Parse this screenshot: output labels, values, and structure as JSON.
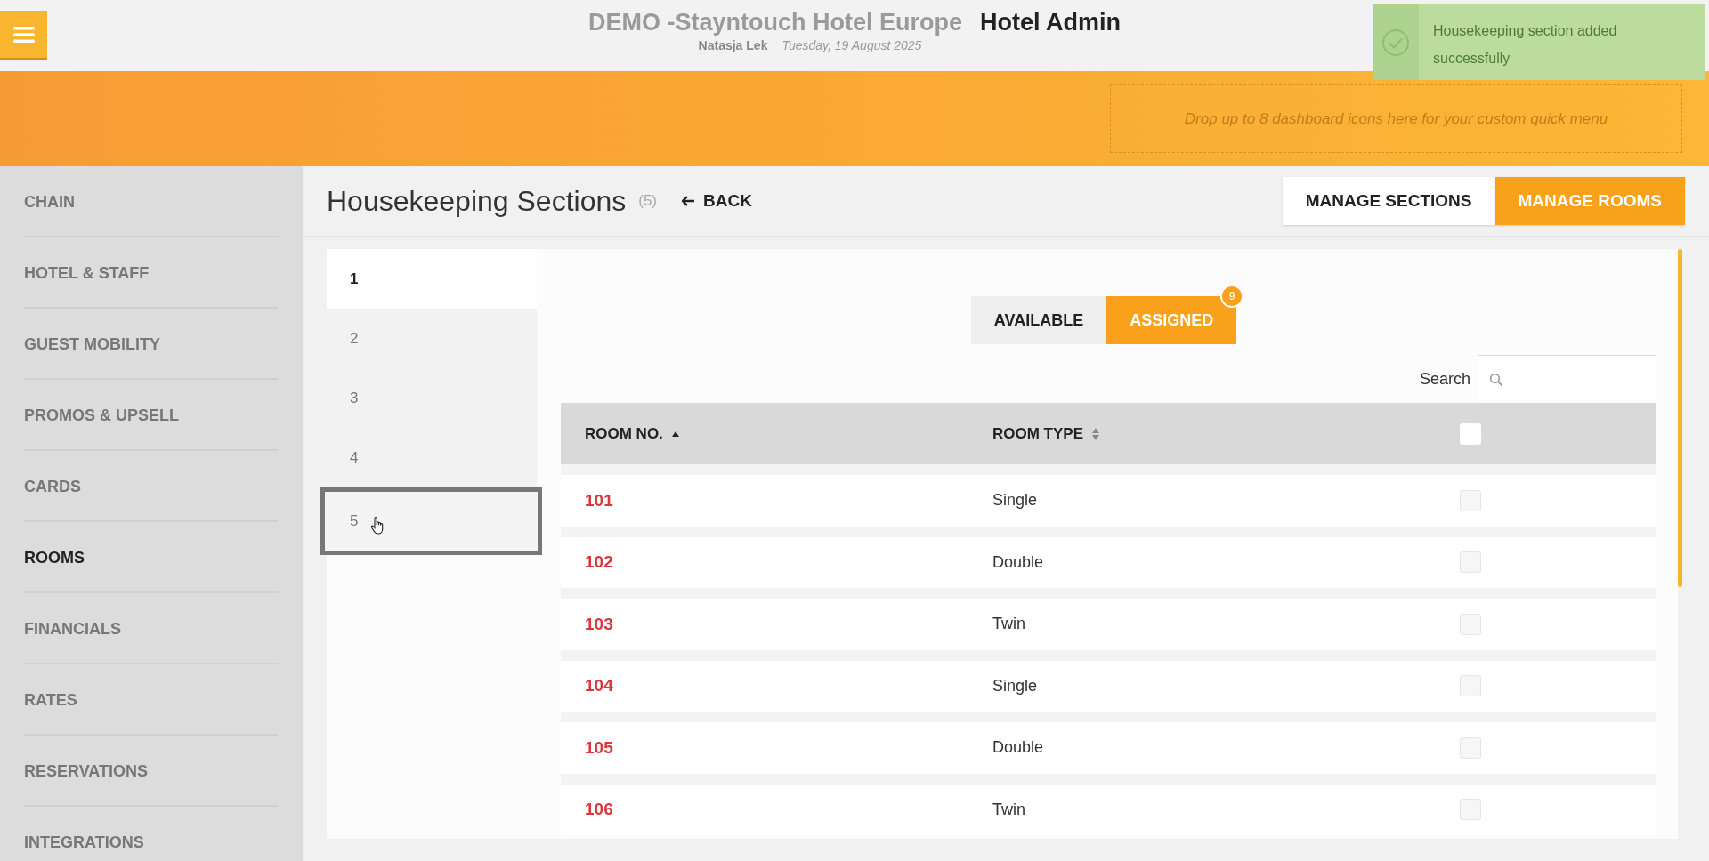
{
  "header": {
    "title": "DEMO -Stayntouch Hotel Europe",
    "app": "Hotel Admin",
    "user": "Natasja Lek",
    "date": "Tuesday, 19 August 2025"
  },
  "toast": {
    "message": "Housekeeping section added successfully"
  },
  "quick_menu": {
    "hint": "Drop up to 8 dashboard icons here for your custom quick menu"
  },
  "sidebar": {
    "items": [
      {
        "label": "CHAIN",
        "selected": false
      },
      {
        "label": "HOTEL & STAFF",
        "selected": false
      },
      {
        "label": "GUEST MOBILITY",
        "selected": false
      },
      {
        "label": "PROMOS & UPSELL",
        "selected": false
      },
      {
        "label": "CARDS",
        "selected": false
      },
      {
        "label": "ROOMS",
        "selected": true
      },
      {
        "label": "FINANCIALS",
        "selected": false
      },
      {
        "label": "RATES",
        "selected": false
      },
      {
        "label": "RESERVATIONS",
        "selected": false
      },
      {
        "label": "INTEGRATIONS",
        "selected": false
      }
    ]
  },
  "page": {
    "title": "Housekeeping Sections",
    "count": "(5)",
    "back": "BACK",
    "buttons": [
      {
        "label": "MANAGE SECTIONS",
        "selected": false
      },
      {
        "label": "MANAGE ROOMS",
        "selected": true
      }
    ]
  },
  "sections": [
    {
      "label": "1",
      "selected": true,
      "hovered": false
    },
    {
      "label": "2",
      "selected": false,
      "hovered": false
    },
    {
      "label": "3",
      "selected": false,
      "hovered": false
    },
    {
      "label": "4",
      "selected": false,
      "hovered": false
    },
    {
      "label": "5",
      "selected": false,
      "hovered": true
    }
  ],
  "toggle": [
    {
      "label": "AVAILABLE",
      "selected": false
    },
    {
      "label": "ASSIGNED",
      "selected": true,
      "badge": "9"
    }
  ],
  "search": {
    "label": "Search"
  },
  "table": {
    "columns": [
      {
        "label": "ROOM NO.",
        "sorted": true
      },
      {
        "label": "ROOM TYPE",
        "sorted": false
      }
    ],
    "all_checked": false,
    "rows": [
      {
        "room": "101",
        "type": "Single",
        "checked": false
      },
      {
        "room": "102",
        "type": "Double",
        "checked": false
      },
      {
        "room": "103",
        "type": "Twin",
        "checked": false
      },
      {
        "room": "104",
        "type": "Single",
        "checked": false
      },
      {
        "room": "105",
        "type": "Double",
        "checked": false
      },
      {
        "room": "106",
        "type": "Twin",
        "checked": false
      }
    ]
  }
}
